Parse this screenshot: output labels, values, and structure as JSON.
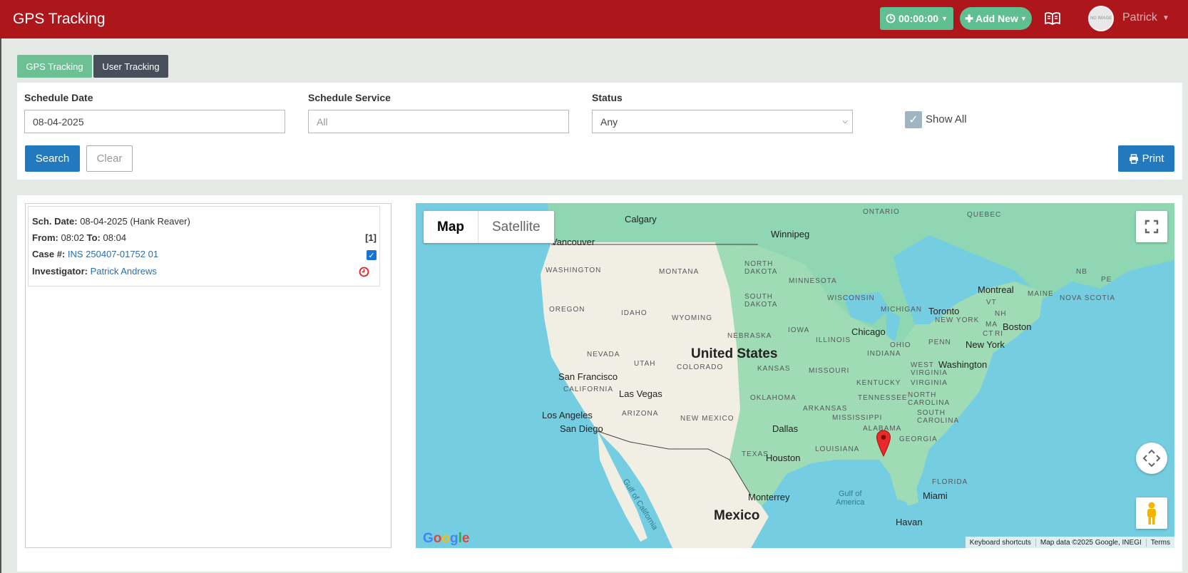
{
  "header": {
    "title": "GPS Tracking",
    "timer": "00:00:00",
    "add_new": "Add New",
    "avatar_text": "NO IMAGE",
    "user_name": "Patrick",
    "colors": {
      "header_bg": "#ad161b",
      "accent_green": "#5fbf91",
      "primary_blue": "#2379bd"
    }
  },
  "tabs": [
    {
      "label": "GPS Tracking",
      "active": true
    },
    {
      "label": "User Tracking",
      "active": false
    }
  ],
  "filters": {
    "schedule_date_label": "Schedule Date",
    "schedule_date_value": "08-04-2025",
    "schedule_service_label": "Schedule Service",
    "schedule_service_placeholder": "All",
    "status_label": "Status",
    "status_value": "Any",
    "show_all_label": "Show All",
    "show_all_checked": true,
    "search_label": "Search",
    "clear_label": "Clear",
    "print_label": "Print"
  },
  "schedule_card": {
    "sch_date_label": "Sch. Date:",
    "sch_date_value": "08-04-2025 (Hank Reaver)",
    "from_label": "From:",
    "from_value": "08:02",
    "to_label": "To:",
    "to_value": "08:04",
    "count": "[1]",
    "case_label": "Case #:",
    "case_value": "INS 250407-01752 01",
    "investigator_label": "Investigator:",
    "investigator_value": "Patrick Andrews",
    "checked": true
  },
  "map": {
    "type_map": "Map",
    "type_satellite": "Satellite",
    "logo": "Google",
    "attribution": {
      "shortcuts": "Keyboard shortcuts",
      "data": "Map data ©2025 Google, INEGI",
      "terms": "Terms"
    },
    "labels": {
      "calgary": "Calgary",
      "ontario": "ONTARIO",
      "quebec": "QUEBEC",
      "winnipeg": "Winnipeg",
      "vancouver": "Vancouver",
      "washington_state": "WASHINGTON",
      "montana": "MONTANA",
      "north_dakota": "NORTH\nDAKOTA",
      "minnesota": "MINNESOTA",
      "nb": "NB",
      "pe": "PE",
      "montreal": "Montreal",
      "maine": "MAINE",
      "nova_scotia": "NOVA SCOTIA",
      "oregon": "OREGON",
      "idaho": "IDAHO",
      "wyoming": "WYOMING",
      "south_dakota": "SOUTH\nDAKOTA",
      "wisconsin": "WISCONSIN",
      "michigan": "MICHIGAN",
      "toronto": "Toronto",
      "vt": "VT",
      "nh": "NH",
      "new_york_state": "NEW YORK",
      "ma": "MA",
      "boston": "Boston",
      "ct": "CT",
      "ri": "RI",
      "iowa": "IOWA",
      "chicago": "Chicago",
      "nebraska": "NEBRASKA",
      "illinois": "ILLINOIS",
      "ohio": "OHIO",
      "penn": "PENN",
      "new_york": "New York",
      "united_states": "United States",
      "nevada": "NEVADA",
      "utah": "UTAH",
      "colorado": "COLORADO",
      "kansas": "KANSAS",
      "missouri": "MISSOURI",
      "indiana": "INDIANA",
      "west_virginia": "WEST\nVIRGINIA",
      "washington_dc": "Washington",
      "san_francisco": "San Francisco",
      "california": "CALIFORNIA",
      "kentucky": "KENTUCKY",
      "virginia": "VIRGINIA",
      "las_vegas": "Las Vegas",
      "oklahoma": "OKLAHOMA",
      "tennessee": "TENNESSEE",
      "north_carolina": "NORTH\nCAROLINA",
      "arizona": "ARIZONA",
      "arkansas": "ARKANSAS",
      "los_angeles": "Los Angeles",
      "new_mexico": "NEW MEXICO",
      "mississippi": "MISSISSIPPI",
      "south_carolina": "SOUTH\nCAROLINA",
      "san_diego": "San Diego",
      "dallas": "Dallas",
      "alabama": "ALABAMA",
      "georgia": "GEORGIA",
      "texas": "TEXAS",
      "louisiana": "LOUISIANA",
      "houston": "Houston",
      "gulf_of_california": "Gulf of California",
      "florida": "FLORIDA",
      "gulf_of_america": "Gulf of\nAmerica",
      "monterrey": "Monterrey",
      "miami": "Miami",
      "mexico": "Mexico",
      "havana": "Havan"
    }
  }
}
